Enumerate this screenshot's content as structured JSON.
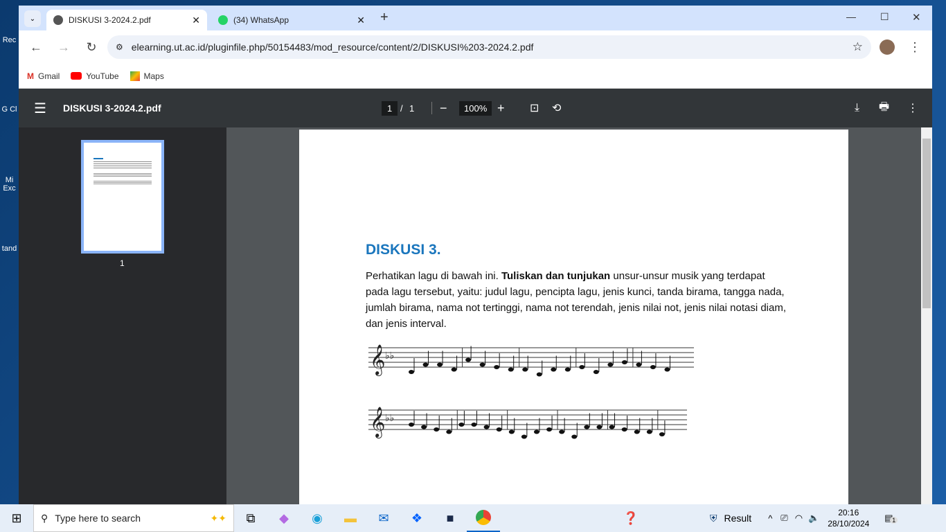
{
  "desktop": {
    "icons": [
      "Rec",
      "G Cl",
      "Mi Exc",
      "tand"
    ]
  },
  "tabs": [
    {
      "title": "DISKUSI 3-2024.2.pdf",
      "icon": "globe-icon"
    },
    {
      "title": "(34) WhatsApp",
      "icon": "whatsapp-icon"
    }
  ],
  "address": {
    "url": "elearning.ut.ac.id/pluginfile.php/50154483/mod_resource/content/2/DISKUSI%203-2024.2.pdf"
  },
  "bookmarks": [
    {
      "label": "Gmail"
    },
    {
      "label": "YouTube"
    },
    {
      "label": "Maps"
    }
  ],
  "pdf": {
    "title": "DISKUSI 3-2024.2.pdf",
    "page_current": "1",
    "page_sep": "/",
    "page_total": "1",
    "zoom": "100%",
    "thumb_label": "1"
  },
  "document": {
    "heading": "DISKUSI 3.",
    "p_intro": "Perhatikan lagu di bawah ini. ",
    "p_bold": "Tuliskan dan tunjukan",
    "p_rest": " unsur-unsur musik yang terdapat pada lagu tersebut, yaitu: judul lagu, pencipta lagu, jenis kunci, tanda birama, tangga nada, jumlah birama, nama not tertinggi, nama not terendah, jenis nilai not, jenis nilai notasi diam, dan  jenis interval.",
    "heading_color": "#1a76bd"
  },
  "taskbar": {
    "search_placeholder": "Type here to search",
    "weather": "Result",
    "time": "20:16",
    "date": "28/10/2024",
    "notif_count": "1"
  }
}
